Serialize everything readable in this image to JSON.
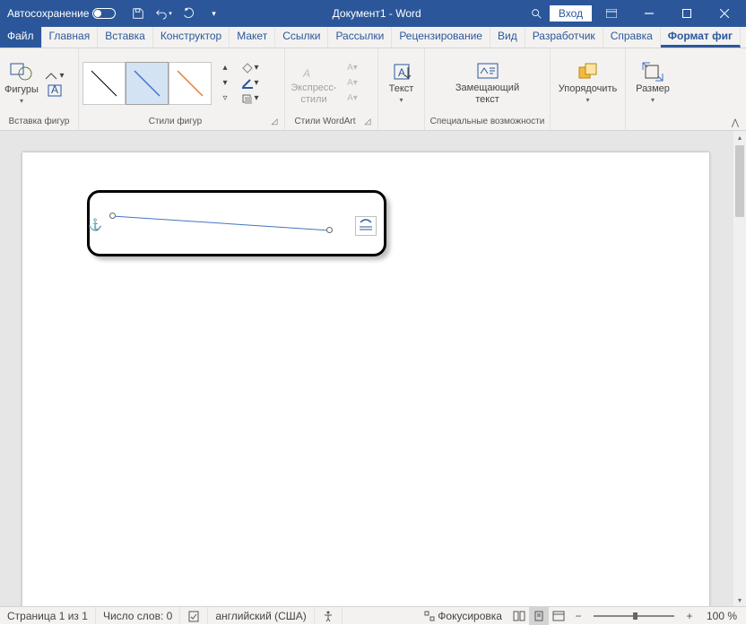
{
  "titlebar": {
    "autosave_label": "Автосохранение",
    "doc_title": "Документ1 - Word",
    "login": "Вход"
  },
  "tabs": {
    "file": "Файл",
    "items": [
      {
        "label": "Главная"
      },
      {
        "label": "Вставка"
      },
      {
        "label": "Конструктор"
      },
      {
        "label": "Макет"
      },
      {
        "label": "Ссылки"
      },
      {
        "label": "Рассылки"
      },
      {
        "label": "Рецензирование"
      },
      {
        "label": "Вид"
      },
      {
        "label": "Разработчик"
      },
      {
        "label": "Справка"
      }
    ],
    "active": "Формат фиг"
  },
  "ribbon": {
    "insert_shapes": {
      "shapes_label": "Фигуры",
      "group_label": "Вставка фигур"
    },
    "shape_styles": {
      "group_label": "Стили фигур"
    },
    "wordart": {
      "express_label": "Экспресс-стили",
      "group_label": "Стили WordArt"
    },
    "text": {
      "text_label": "Текст"
    },
    "accessibility": {
      "alt_label": "Замещающий текст",
      "group_label": "Специальные возможности"
    },
    "arrange": {
      "arrange_label": "Упорядочить"
    },
    "size": {
      "size_label": "Размер"
    }
  },
  "statusbar": {
    "page": "Страница 1 из 1",
    "words": "Число слов: 0",
    "lang": "английский (США)",
    "focus": "Фокусировка",
    "zoom_pct": "100 %"
  }
}
